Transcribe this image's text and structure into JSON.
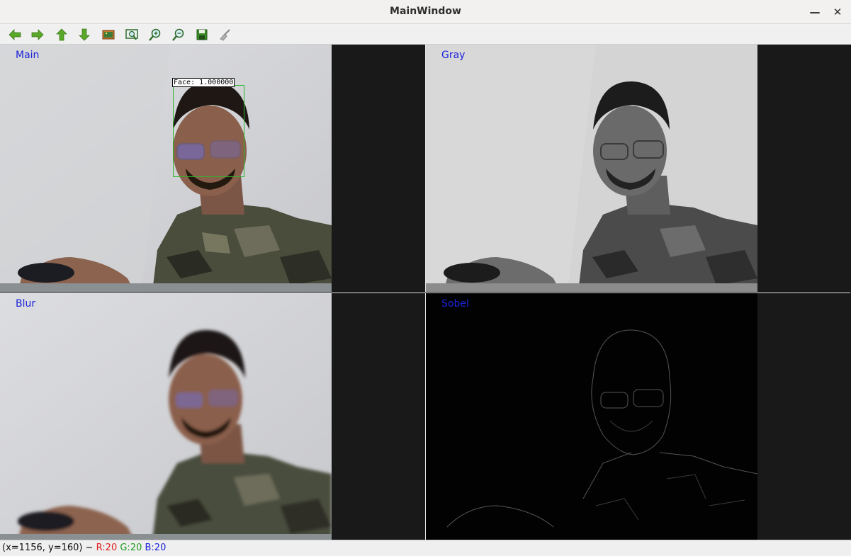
{
  "window": {
    "title": "MainWindow",
    "minimize_glyph": "—",
    "close_glyph": "✕"
  },
  "toolbar": {
    "buttons": [
      {
        "name": "pan-left",
        "icon": "arrow-left-icon"
      },
      {
        "name": "pan-right",
        "icon": "arrow-right-icon"
      },
      {
        "name": "pan-up",
        "icon": "arrow-up-icon"
      },
      {
        "name": "pan-down",
        "icon": "arrow-down-icon"
      },
      {
        "name": "zoom-original",
        "icon": "image-icon"
      },
      {
        "name": "zoom-fit",
        "icon": "zoom-fit-icon"
      },
      {
        "name": "zoom-in",
        "icon": "zoom-in-icon"
      },
      {
        "name": "zoom-out",
        "icon": "zoom-out-icon"
      },
      {
        "name": "save",
        "icon": "save-icon"
      },
      {
        "name": "properties",
        "icon": "brush-icon"
      }
    ],
    "accent": "#5aa82a"
  },
  "panes": {
    "main": {
      "label": "Main",
      "face_label": "Face: 1.000000"
    },
    "gray": {
      "label": "Gray"
    },
    "blur": {
      "label": "Blur"
    },
    "sobel": {
      "label": "Sobel"
    }
  },
  "status": {
    "coords": "(x=1156, y=160) ~",
    "r": "R:20",
    "g": "G:20",
    "b": "B:20"
  },
  "colors": {
    "label_blue": "#1a22d8",
    "face_box_green": "#2cb52c"
  }
}
